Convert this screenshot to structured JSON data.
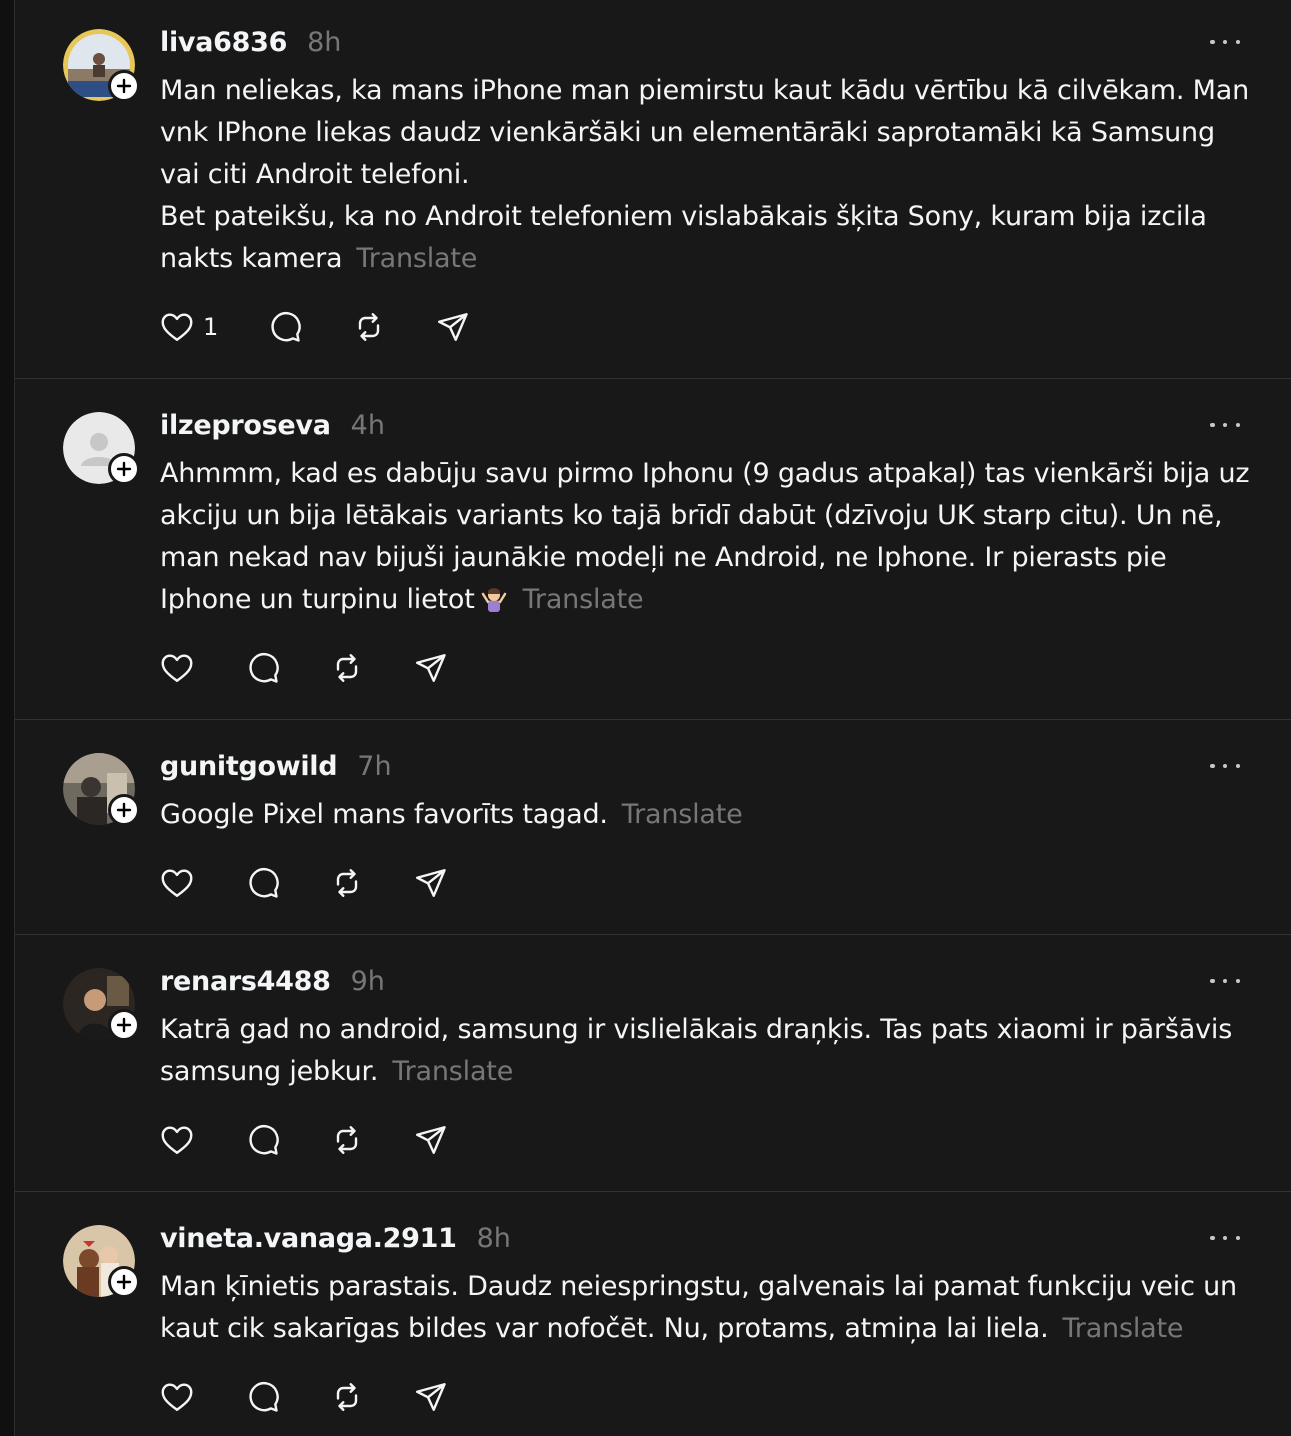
{
  "posts": [
    {
      "username": "liva6836",
      "time": "8h",
      "text": "Man neliekas, ka mans iPhone man piemirstu kaut kādu vērtību kā cilvēkam. Man vnk IPhone liekas daudz vienkāršāki un elementārāki saprotamāki kā Samsung vai citi Androit telefoni.\nBet pateikšu, ka no Androit telefoniem vislabākais šķita Sony, kuram bija izcila nakts kamera",
      "translate": "Translate",
      "like_count": "1"
    },
    {
      "username": "ilzeproseva",
      "time": "4h",
      "text": "Ahmmm, kad es dabūju savu pirmo Iphonu (9 gadus atpakaļ) tas vienkārši bija uz akciju un bija lētākais variants ko tajā brīdī dabūt (dzīvoju UK starp citu). Un nē, man nekad nav bijuši jaunākie modeļi ne Android, ne Iphone. Ir pierasts pie Iphone un turpinu lietot",
      "translate": "Translate",
      "like_count": ""
    },
    {
      "username": "gunitgowild",
      "time": "7h",
      "text": "Google Pixel mans favorīts tagad.",
      "translate": "Translate",
      "like_count": ""
    },
    {
      "username": "renars4488",
      "time": "9h",
      "text": "Katrā gad no android, samsung ir vislielākais draņķis. Tas pats xiaomi ir pāršāvis samsung jebkur.",
      "translate": "Translate",
      "like_count": ""
    },
    {
      "username": "vineta.vanaga.2911",
      "time": "8h",
      "text": "Man ķīnietis parastais. Daudz neiespringstu, galvenais lai pamat funkciju veic un kaut cik sakarīgas bildes var nofočēt. Nu, protams, atmiņa lai liela.",
      "translate": "Translate",
      "like_count": ""
    }
  ],
  "icons": {
    "like": "heart-icon",
    "reply": "comment-icon",
    "repost": "repost-icon",
    "share": "send-icon",
    "more": "more-dots-icon",
    "follow": "plus-icon",
    "emoji": "person-shrugging-emoji"
  },
  "colors": {
    "background": "#181818",
    "text": "#f3f5f7",
    "muted": "#777777",
    "divider": "#323232"
  }
}
